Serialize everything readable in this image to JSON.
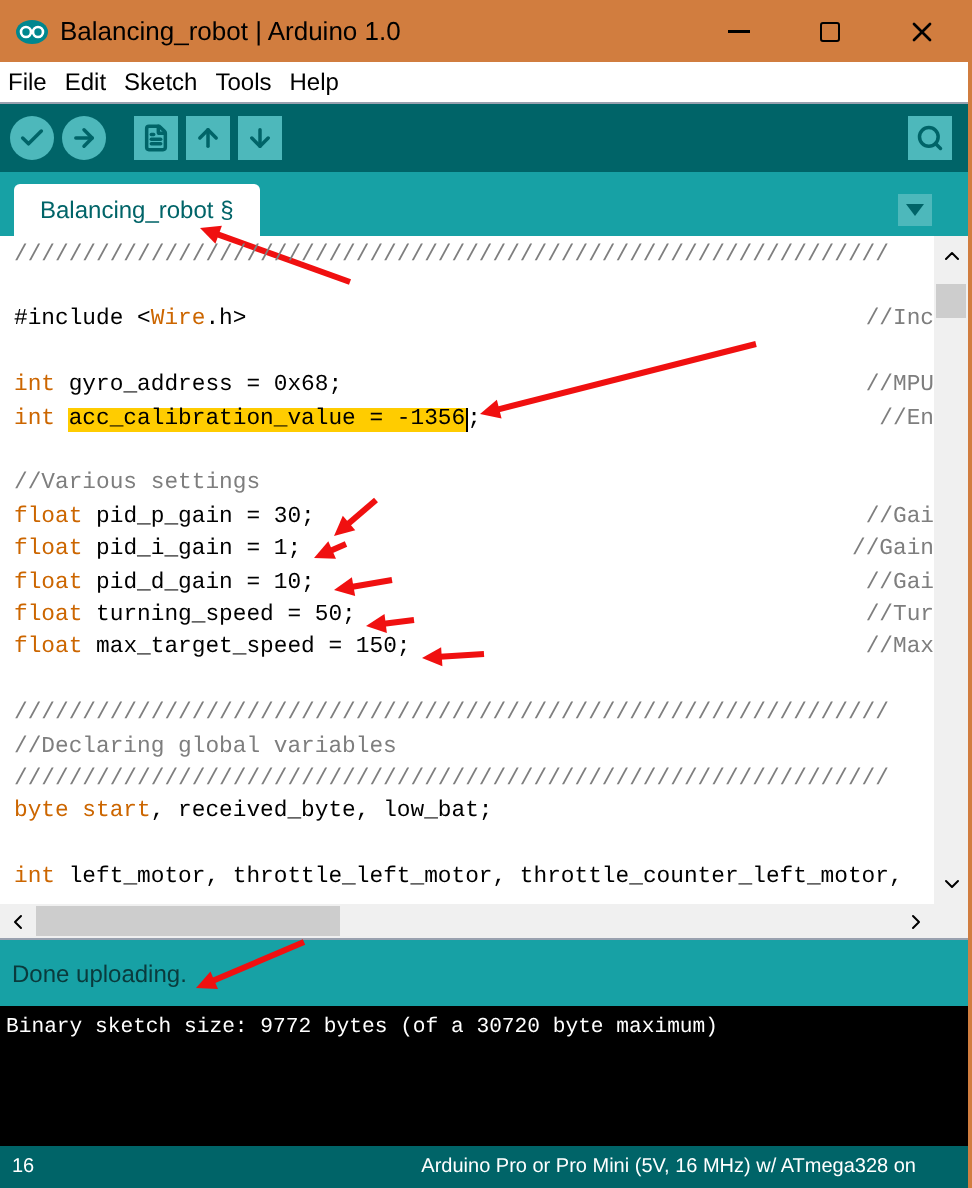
{
  "window": {
    "title": "Balancing_robot | Arduino 1.0"
  },
  "menu": [
    "File",
    "Edit",
    "Sketch",
    "Tools",
    "Help"
  ],
  "tabs": [
    {
      "label": "Balancing_robot §",
      "selected": true
    }
  ],
  "editor": {
    "lines": [
      {
        "kind": "code",
        "tokens": [
          {
            "kind": "comment",
            "text": "////////////////////////////////////////////////////////////////"
          }
        ]
      },
      {
        "kind": "blank"
      },
      {
        "kind": "code",
        "tokens": [
          {
            "kind": "plain",
            "text": "#include <"
          },
          {
            "kind": "library",
            "text": "Wire"
          },
          {
            "kind": "plain",
            "text": ".h>"
          }
        ],
        "comment": "//Inc"
      },
      {
        "kind": "blank"
      },
      {
        "kind": "code",
        "tokens": [
          {
            "kind": "keyword",
            "text": "int"
          },
          {
            "kind": "plain",
            "text": " gyro_address = 0x68;"
          }
        ],
        "comment": "//MPU"
      },
      {
        "kind": "code",
        "tokens": [
          {
            "kind": "keyword",
            "text": "int "
          },
          {
            "kind": "selected",
            "text": "acc_calibration_value = -1356"
          },
          {
            "kind": "plain",
            "text": ";"
          }
        ],
        "comment": "//En"
      },
      {
        "kind": "blank"
      },
      {
        "kind": "code",
        "tokens": [
          {
            "kind": "comment",
            "text": "//Various settings"
          }
        ]
      },
      {
        "kind": "code",
        "tokens": [
          {
            "kind": "keyword",
            "text": "float"
          },
          {
            "kind": "plain",
            "text": " pid_p_gain = 30;"
          }
        ],
        "comment": "//Gai"
      },
      {
        "kind": "code",
        "tokens": [
          {
            "kind": "keyword",
            "text": "float"
          },
          {
            "kind": "plain",
            "text": " pid_i_gain = 1;"
          }
        ],
        "comment": "//Gain"
      },
      {
        "kind": "code",
        "tokens": [
          {
            "kind": "keyword",
            "text": "float"
          },
          {
            "kind": "plain",
            "text": " pid_d_gain = 10;"
          }
        ],
        "comment": "//Gai"
      },
      {
        "kind": "code",
        "tokens": [
          {
            "kind": "keyword",
            "text": "float"
          },
          {
            "kind": "plain",
            "text": " turning_speed = 50;"
          }
        ],
        "comment": "//Tur"
      },
      {
        "kind": "code",
        "tokens": [
          {
            "kind": "keyword",
            "text": "float"
          },
          {
            "kind": "plain",
            "text": " max_target_speed = 150;"
          }
        ],
        "comment": "//Max"
      },
      {
        "kind": "blank"
      },
      {
        "kind": "code",
        "tokens": [
          {
            "kind": "comment",
            "text": "////////////////////////////////////////////////////////////////"
          }
        ]
      },
      {
        "kind": "code",
        "tokens": [
          {
            "kind": "comment",
            "text": "//Declaring global variables"
          }
        ]
      },
      {
        "kind": "code",
        "tokens": [
          {
            "kind": "comment",
            "text": "////////////////////////////////////////////////////////////////"
          }
        ]
      },
      {
        "kind": "code",
        "tokens": [
          {
            "kind": "keyword",
            "text": "byte start"
          },
          {
            "kind": "plain",
            "text": ", received_byte, low_bat;"
          }
        ]
      },
      {
        "kind": "blank"
      },
      {
        "kind": "code",
        "tokens": [
          {
            "kind": "keyword",
            "text": "int"
          },
          {
            "kind": "plain",
            "text": " left_motor, throttle_left_motor, throttle_counter_left_motor,"
          }
        ]
      }
    ]
  },
  "status": "Done uploading.",
  "console": [
    "Binary sketch size: 9772 bytes (of a 30720 byte maximum)"
  ],
  "bottom_bar": {
    "line": "16",
    "board": "Arduino Pro or Pro Mini (5V, 16 MHz) w/ ATmega328 on"
  }
}
